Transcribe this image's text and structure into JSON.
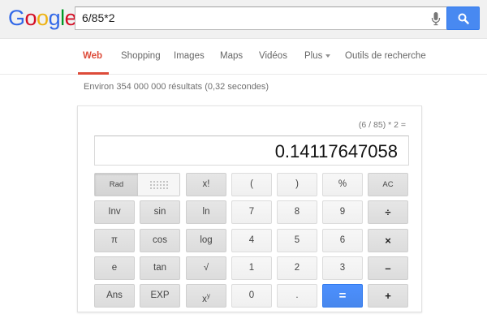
{
  "header": {
    "logo_letters": [
      {
        "char": "G",
        "color": "#3369e8"
      },
      {
        "char": "o",
        "color": "#d50f25"
      },
      {
        "char": "o",
        "color": "#eeb211"
      },
      {
        "char": "g",
        "color": "#3369e8"
      },
      {
        "char": "l",
        "color": "#009925"
      },
      {
        "char": "e",
        "color": "#d50f25"
      }
    ],
    "query": "6/85*2",
    "icons": {
      "mic": "microphone-icon",
      "search": "search-icon"
    }
  },
  "tabs": [
    {
      "label": "Web",
      "active": true
    },
    {
      "label": "Shopping"
    },
    {
      "label": "Images"
    },
    {
      "label": "Maps"
    },
    {
      "label": "Vidéos"
    },
    {
      "label": "Plus"
    },
    {
      "label": "Outils de recherche"
    }
  ],
  "results_count": "Environ 354 000 000 résultats (0,32 secondes)",
  "calculator": {
    "expression": "(6 / 85) * 2 =",
    "result": "0.14117647058",
    "rad_label": "Rad",
    "deg_label": "Deg",
    "keys": {
      "fact": "x!",
      "lparen": "(",
      "rparen": ")",
      "percent": "%",
      "ac": "AC",
      "inv": "Inv",
      "sin": "sin",
      "ln": "ln",
      "seven": "7",
      "eight": "8",
      "nine": "9",
      "divide": "÷",
      "pi": "π",
      "cos": "cos",
      "log": "log",
      "four": "4",
      "five": "5",
      "six": "6",
      "multiply": "×",
      "e": "e",
      "tan": "tan",
      "sqrt": "√",
      "one": "1",
      "two": "2",
      "three": "3",
      "minus": "–",
      "ans": "Ans",
      "exp": "EXP",
      "pow_base": "x",
      "pow_exp": "y",
      "zero": "0",
      "dot": ".",
      "equals": "=",
      "plus": "+"
    },
    "colors": {
      "accent": "#4d90fe",
      "tab_active": "#dd4b39"
    }
  }
}
